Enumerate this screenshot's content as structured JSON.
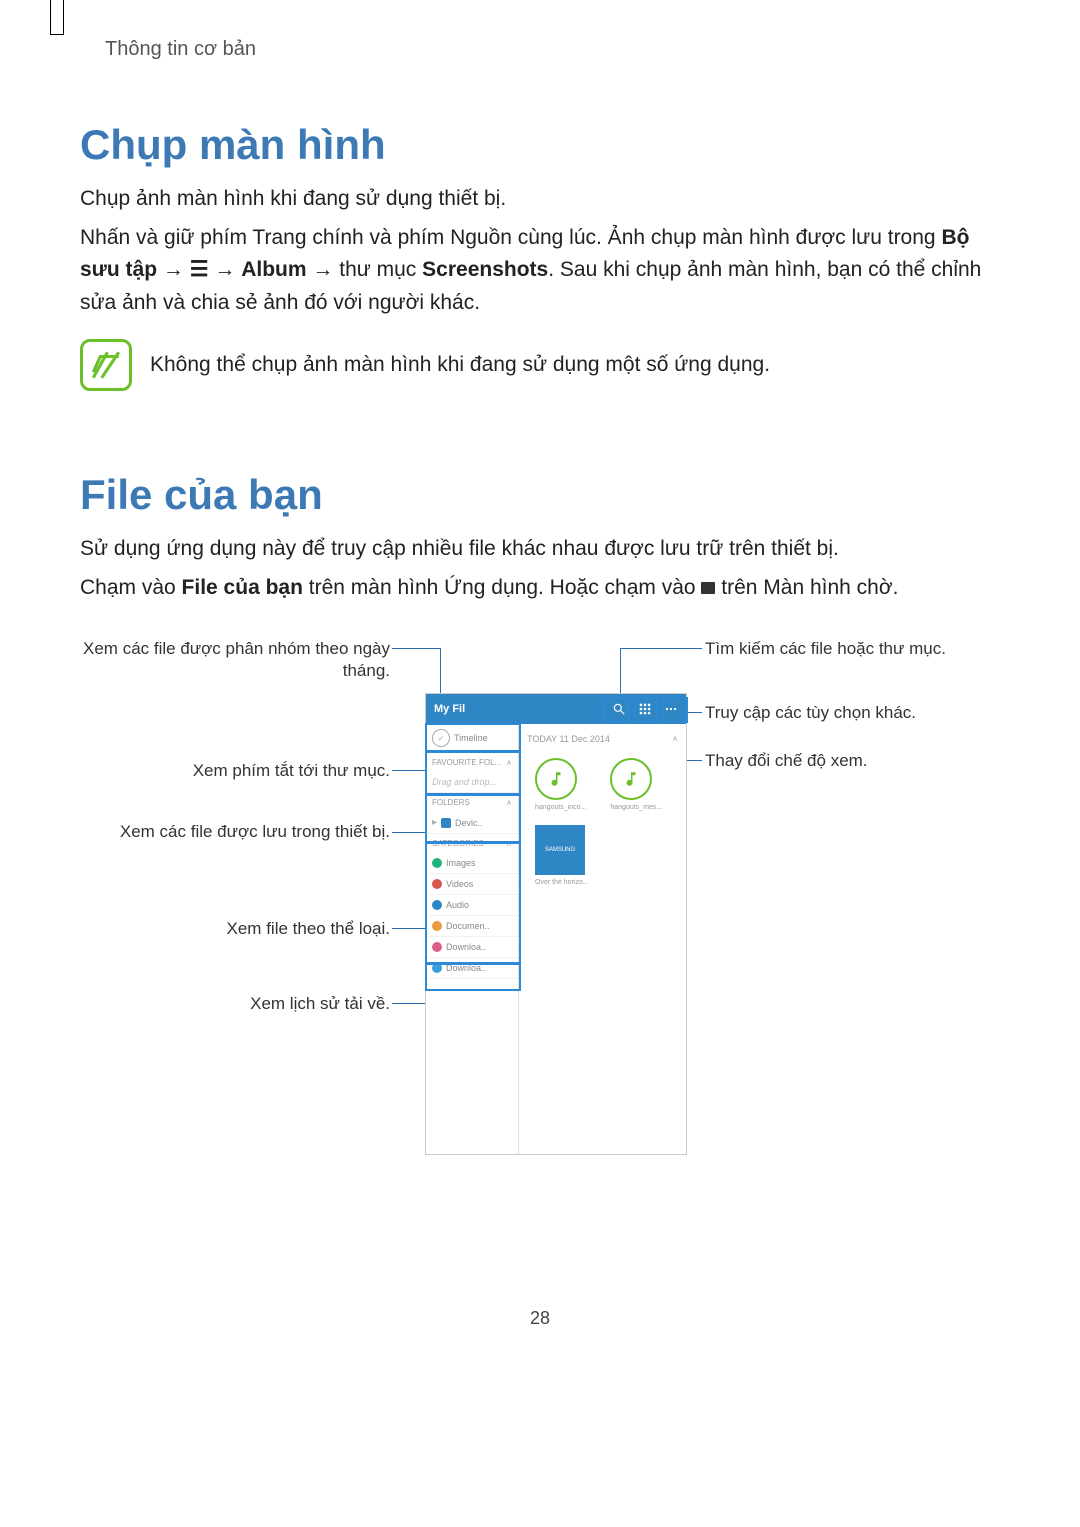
{
  "header": {
    "breadcrumb": "Thông tin cơ bản"
  },
  "section1": {
    "title": "Chụp màn hình",
    "p1": "Chụp ảnh màn hình khi đang sử dụng thiết bị.",
    "p2a": "Nhấn và giữ phím Trang chính và phím Nguồn cùng lúc. Ảnh chụp màn hình được lưu trong ",
    "p2b_bold": "Bộ sưu tập",
    "arrow": " → ",
    "p2c_bold": "Album",
    "p2d": " → thư mục ",
    "p2e_bold": "Screenshots",
    "p2f": ". Sau khi chụp ảnh màn hình, bạn có thể chỉnh sửa ảnh và chia sẻ ảnh đó với người khác.",
    "note": "Không thể chụp ảnh màn hình khi đang sử dụng một số ứng dụng."
  },
  "section2": {
    "title": "File của bạn",
    "p1": "Sử dụng ứng dụng này để truy cập nhiều file khác nhau được lưu trữ trên thiết bị.",
    "p2a": "Chạm vào ",
    "p2b_bold": "File của bạn",
    "p2c": " trên màn hình Ứng dụng. Hoặc chạm vào ",
    "p2d": " trên Màn hình chờ."
  },
  "callouts": {
    "left1": "Xem các file được phân nhóm theo ngày tháng.",
    "left2": "Xem phím tắt tới thư mục.",
    "left3": "Xem các file được lưu trong thiết bị.",
    "left4": "Xem file theo thể loại.",
    "left5": "Xem lịch sử tải về.",
    "right1": "Tìm kiếm các file hoặc thư mục.",
    "right2": "Truy cập các tùy chọn khác.",
    "right3": "Thay đổi chế độ xem."
  },
  "device": {
    "title": "My Fil",
    "date": "TODAY 11 Dec 2014",
    "timeline": "Timeline",
    "fav": "FAVOURITE FOL...",
    "drag": "Drag and drop...",
    "folders": "FOLDERS",
    "device_storage": "Devic..",
    "categories": "CATEGORIES",
    "images": "Images",
    "videos": "Videos",
    "audio": "Audio",
    "documents": "Documen..",
    "downloads": "Downloa..",
    "dlhistory": "Downloa..",
    "caption1": "hangouts_inco...",
    "caption2": "hangouts_mes...",
    "caption3": "Over the horizo...",
    "samsung": "SAMSUNG"
  },
  "page_number": "28"
}
